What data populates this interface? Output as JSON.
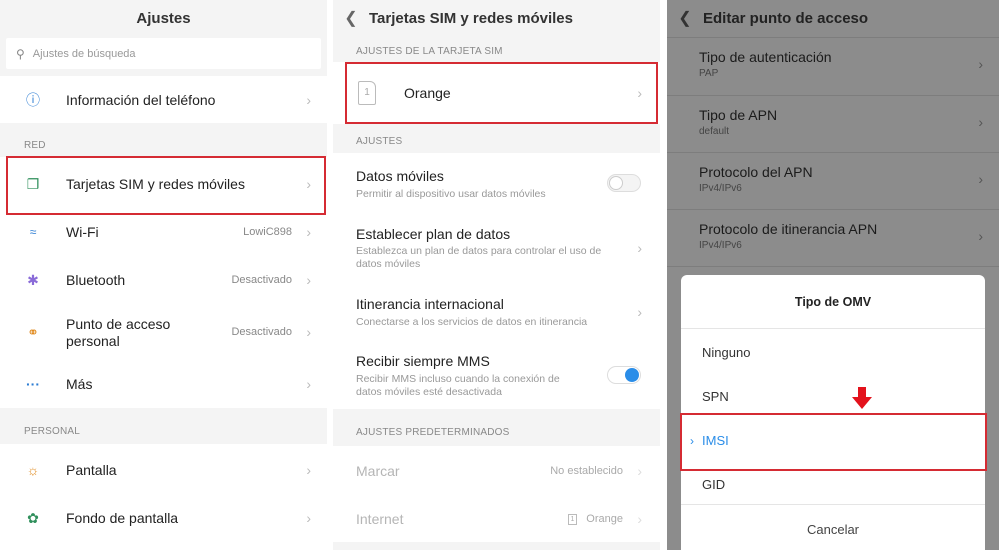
{
  "panel1": {
    "title": "Ajustes",
    "search_placeholder": "Ajustes de búsqueda",
    "info_item": "Información del teléfono",
    "section_red": "RED",
    "red_items": [
      {
        "label": "Tarjetas SIM y redes móviles",
        "value": "",
        "icon": "sim-card-icon"
      },
      {
        "label": "Wi-Fi",
        "value": "LowiC898",
        "icon": "wifi-icon"
      },
      {
        "label": "Bluetooth",
        "value": "Desactivado",
        "icon": "bluetooth-icon"
      },
      {
        "label_line1": "Punto de acceso",
        "label_line2": "personal",
        "value": "Desactivado",
        "icon": "hotspot-icon"
      },
      {
        "label": "Más",
        "value": "",
        "icon": "more-icon"
      }
    ],
    "section_personal": "PERSONAL",
    "personal_items": [
      {
        "label": "Pantalla",
        "icon": "display-icon"
      },
      {
        "label": "Fondo de pantalla",
        "icon": "wallpaper-icon"
      }
    ],
    "icon_colors": {
      "info": "#2b7cd3",
      "sim": "#2f8f5b",
      "wifi": "#2b7cd3",
      "bluetooth": "#8a6bd8",
      "hotspot": "#e08a1e",
      "more": "#2b7cd3",
      "display": "#e08a1e",
      "wallpaper": "#2f8f5b"
    }
  },
  "panel2": {
    "title": "Tarjetas SIM y redes móviles",
    "section_sim": "AJUSTES DE LA TARJETA SIM",
    "sim_index": "1",
    "sim_name": "Orange",
    "section_ajustes": "AJUSTES",
    "datos": {
      "title": "Datos móviles",
      "sub": "Permitir al dispositivo usar datos móviles",
      "toggle_on": false
    },
    "plan": {
      "title": "Establecer plan de datos",
      "sub1": "Establezca un plan de datos para controlar el uso de",
      "sub2": "datos móviles"
    },
    "itinerancia": {
      "title": "Itinerancia internacional",
      "sub": "Conectarse a los servicios de datos en itinerancia"
    },
    "mms": {
      "title": "Recibir siempre MMS",
      "sub1": "Recibir MMS incluso cuando la conexión de",
      "sub2": "datos móviles esté desactivada",
      "toggle_on": true
    },
    "section_default": "AJUSTES PREDETERMINADOS",
    "marcar": {
      "title": "Marcar",
      "value": "No establecido"
    },
    "internet": {
      "title": "Internet",
      "sim_index": "1",
      "value": "Orange"
    }
  },
  "panel3": {
    "title": "Editar punto de acceso",
    "items": [
      {
        "title": "Tipo de autenticación",
        "sub": "PAP"
      },
      {
        "title": "Tipo de APN",
        "sub": "default"
      },
      {
        "title": "Protocolo del APN",
        "sub": "IPv4/IPv6"
      },
      {
        "title": "Protocolo de itinerancia APN",
        "sub": "IPv4/IPv6"
      }
    ],
    "dialog": {
      "title": "Tipo de OMV",
      "options": [
        "Ninguno",
        "SPN",
        "IMSI",
        "GID"
      ],
      "selected": "IMSI",
      "cancel": "Cancelar"
    }
  },
  "colors": {
    "highlight_box": "#d52b33",
    "accent_blue": "#2a8de8",
    "arrow": "#e3121c"
  }
}
